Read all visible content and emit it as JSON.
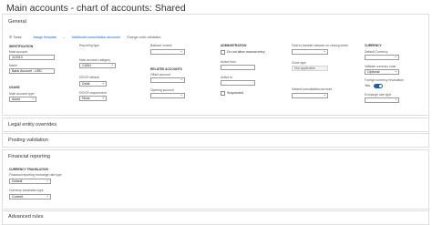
{
  "title": "Main accounts - chart of accounts: Shared",
  "general": {
    "header": "General",
    "toolbar": {
      "totals": "Totals",
      "assign_template": "Assign template",
      "consolidation": "Additional consolidation accounts",
      "change_validation": "Change code validation"
    },
    "identification": {
      "header": "Identification",
      "main_account_label": "Main account",
      "main_account_value": "112010",
      "name_label": "Name",
      "name_value": "Bank Account - USD"
    },
    "type": {
      "header": "Usage",
      "main_account_type_label": "Main account type",
      "main_account_type_value": "Asset"
    },
    "col2": {
      "reporting_type_label": "Reporting type",
      "main_account_category_label": "Main account category",
      "main_account_category_value": "CASH",
      "debit_credit_default_label": "DE/CR default",
      "debit_credit_default_value": "Debit",
      "debit_credit_requirement_label": "DE/CR requirement",
      "debit_credit_requirement_value": "None"
    },
    "col3": {
      "balance_control_label": "Balance control",
      "related_header": "Related accounts",
      "offset_account_label": "Offset account",
      "opening_account_label": "Opening account"
    },
    "administration": {
      "header": "Administration",
      "do_not_allow_manual_entry": "Do not allow manual entry",
      "active_from_label": "Active from",
      "active_to_label": "Active to",
      "suspended": "Suspended"
    },
    "col5": {
      "field_to_transfer_label": "Field to transfer balance on closing sheet",
      "close_type_label": "Close type",
      "close_type_value": "Not applicable",
      "default_consolidation_label": "Default consolidation account"
    },
    "currency": {
      "header": "Currency",
      "default_currency_label": "Default Currency",
      "validate_currency_label": "Validate currency code",
      "validate_currency_value": "Optional",
      "foreign_reval_label": "Foreign currency revaluation",
      "foreign_reval_value": "Yes",
      "exchange_rate_type_label": "Exchange rate type"
    }
  },
  "legal_entity_overrides": {
    "header": "Legal entity overrides"
  },
  "posting_validation": {
    "header": "Posting validation"
  },
  "financial_reporting": {
    "header": "Financial reporting",
    "currency_translation_header": "Currency translation",
    "rate_type_label": "Financial reporting exchange rate type",
    "rate_type_value": "Default",
    "translation_type_label": "Currency translation type",
    "translation_type_value": "Current"
  },
  "advanced_rules": {
    "header": "Advanced rules"
  }
}
